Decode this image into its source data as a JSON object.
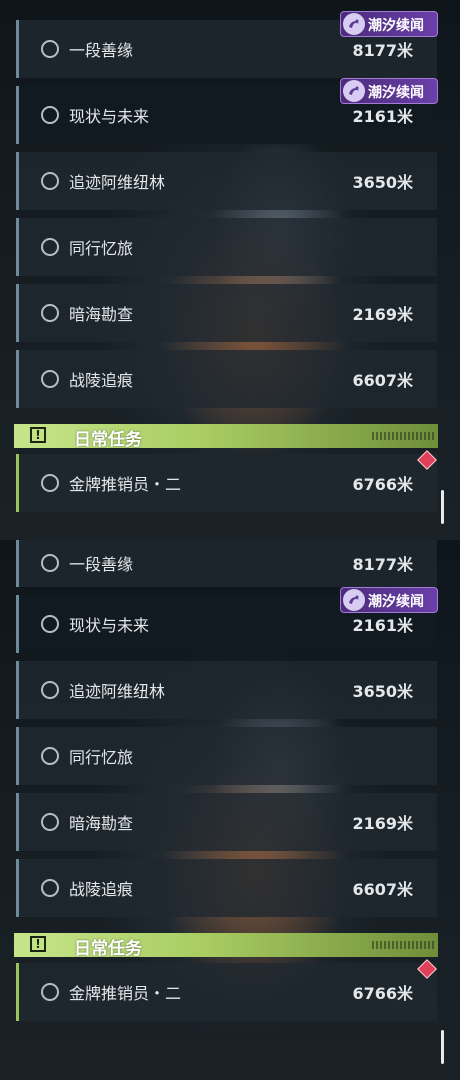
{
  "panels": [
    {
      "badges": [
        "潮汐续闻",
        "潮汐续闻"
      ],
      "quests": [
        {
          "name": "一段善缘",
          "distance": "8177米"
        },
        {
          "name": "现状与未来",
          "distance": "2161米"
        },
        {
          "name": "追迹阿维纽林",
          "distance": "3650米"
        },
        {
          "name": "同行忆旅",
          "distance": ""
        },
        {
          "name": "暗海勘查",
          "distance": "2169米"
        },
        {
          "name": "战陵追痕",
          "distance": "6607米"
        }
      ],
      "daily": {
        "title": "日常任务",
        "quest": {
          "name": "金牌推销员・二",
          "distance": "6766米"
        }
      }
    },
    {
      "badges": [
        "潮汐续闻"
      ],
      "quests": [
        {
          "name": "一段善缘",
          "distance": "8177米"
        },
        {
          "name": "现状与未来",
          "distance": "2161米"
        },
        {
          "name": "追迹阿维纽林",
          "distance": "3650米"
        },
        {
          "name": "同行忆旅",
          "distance": ""
        },
        {
          "name": "暗海勘查",
          "distance": "2169米"
        },
        {
          "name": "战陵追痕",
          "distance": "6607米"
        }
      ],
      "daily": {
        "title": "日常任务",
        "quest": {
          "name": "金牌推销员・二",
          "distance": "6766米"
        }
      }
    }
  ],
  "colors": {
    "accent_daily": "#9bc45a",
    "badge": "#6b3fa8",
    "tracking_marker": "#e0405a"
  },
  "icons": {
    "badge": "tide-emblem-icon",
    "section": "exclamation-icon",
    "quest_status": "radio-circle-icon",
    "tracking": "diamond-marker-icon"
  }
}
